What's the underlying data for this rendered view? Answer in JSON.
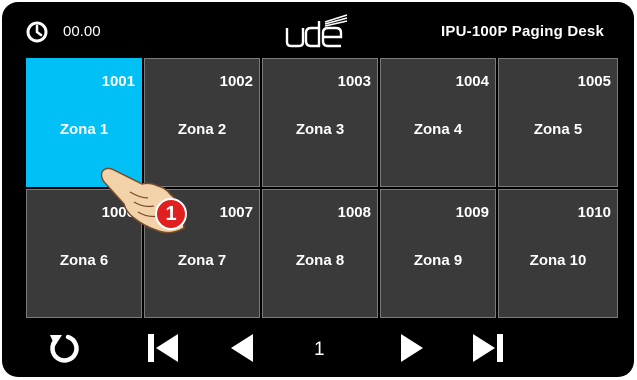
{
  "header": {
    "time": "00.00",
    "logo_text": "ude",
    "title": "IPU-100P  Paging Desk",
    "clock_icon": "clock-icon"
  },
  "zones": [
    {
      "number": "1001",
      "name": "Zona 1",
      "selected": true
    },
    {
      "number": "1002",
      "name": "Zona 2",
      "selected": false
    },
    {
      "number": "1003",
      "name": "Zona 3",
      "selected": false
    },
    {
      "number": "1004",
      "name": "Zona 4",
      "selected": false
    },
    {
      "number": "1005",
      "name": "Zona 5",
      "selected": false
    },
    {
      "number": "1006",
      "name": "Zona 6",
      "selected": false
    },
    {
      "number": "1007",
      "name": "Zona 7",
      "selected": false
    },
    {
      "number": "1008",
      "name": "Zona 8",
      "selected": false
    },
    {
      "number": "1009",
      "name": "Zona 9",
      "selected": false
    },
    {
      "number": "1010",
      "name": "Zona 10",
      "selected": false
    }
  ],
  "footer": {
    "page": "1",
    "icons": [
      "refresh-icon",
      "first-page-icon",
      "previous-page-icon",
      "next-page-icon",
      "last-page-icon"
    ]
  },
  "annotation": {
    "step": "1",
    "icon": "pointing-hand-icon"
  },
  "colors": {
    "background": "#000000",
    "tile": "#3a3a3a",
    "tile_border": "#7a7a7a",
    "selected_tile": "#00c0f6",
    "badge": "#e02020"
  }
}
